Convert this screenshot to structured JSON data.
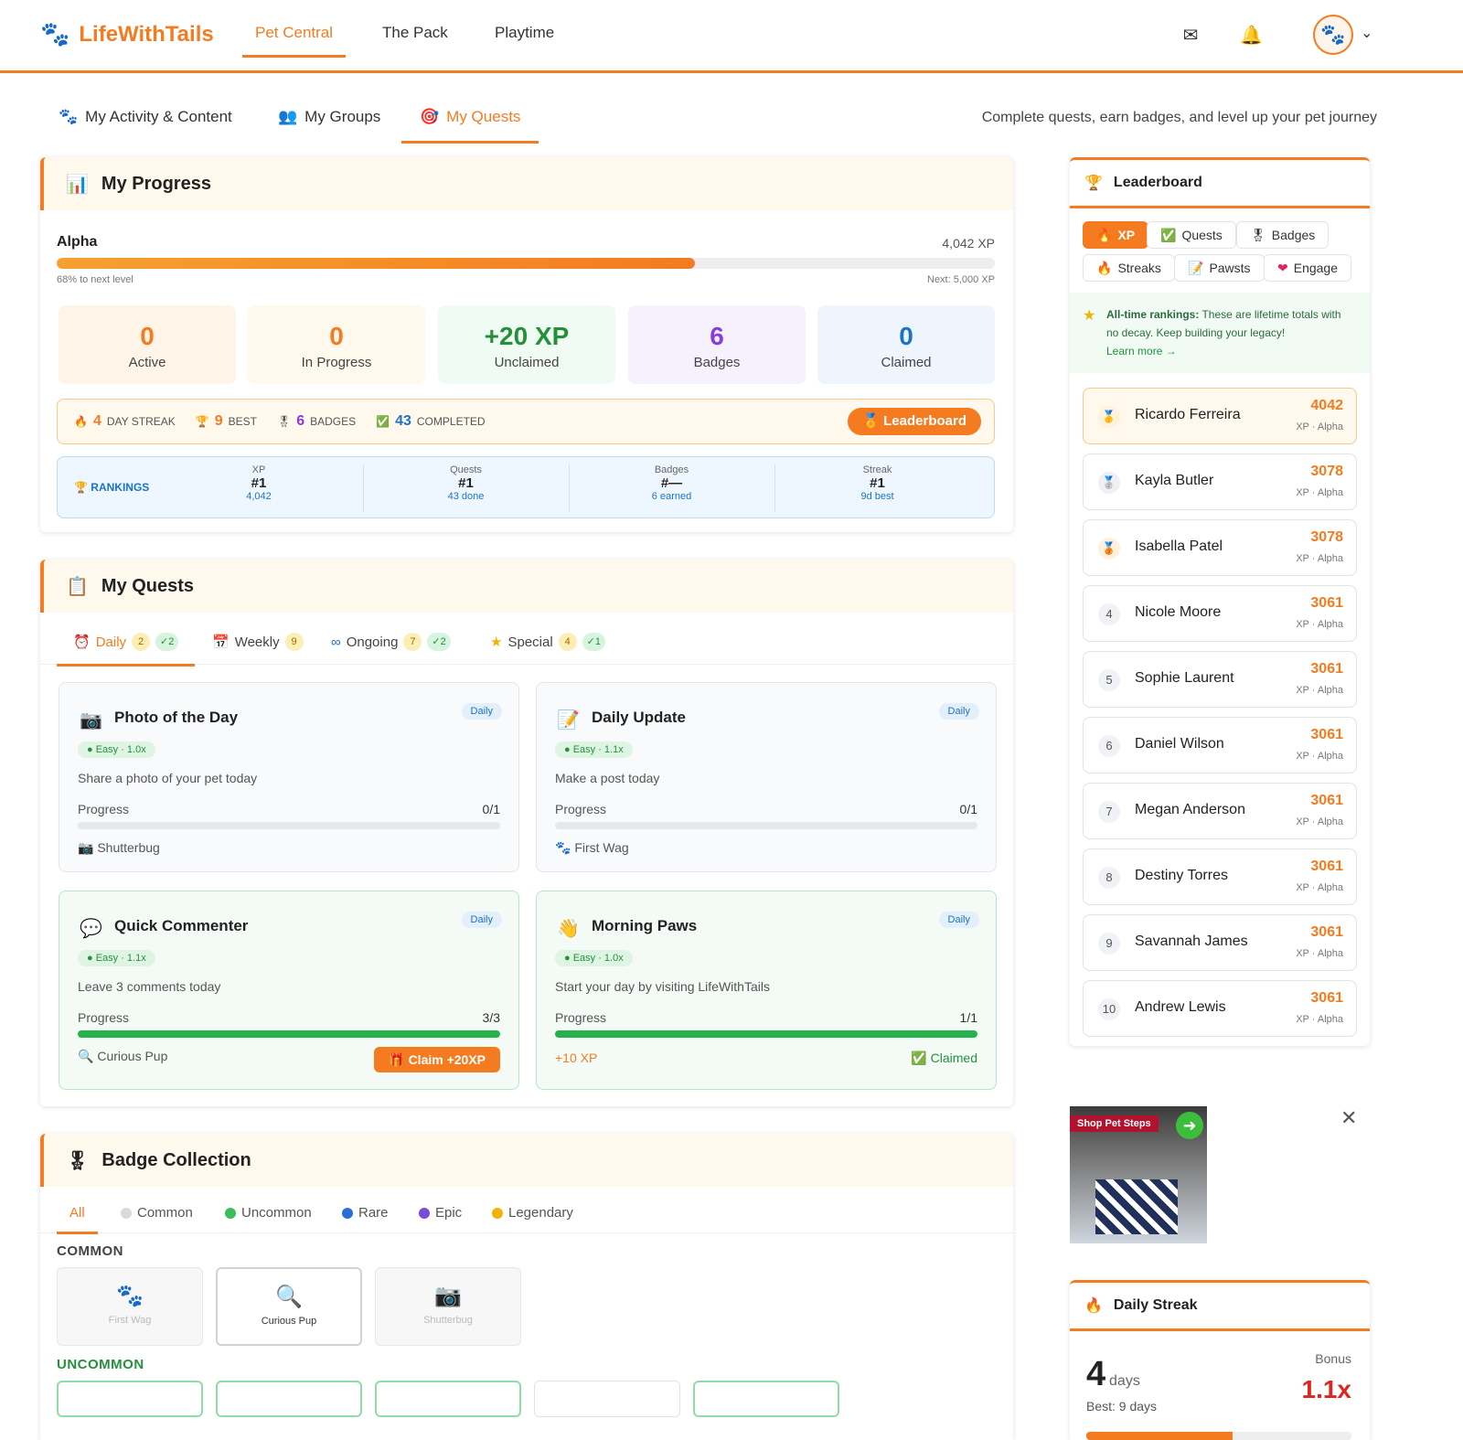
{
  "app": {
    "name": "LifeWithTails"
  },
  "nav": {
    "links": [
      "Pet Central",
      "The Pack",
      "Playtime"
    ]
  },
  "icons": {
    "mail": "mail-icon",
    "bell": "bell-icon",
    "avatar": "paw-avatar",
    "chevron": "chevron-down-icon"
  },
  "subtabs": [
    "My Activity & Content",
    "My Groups",
    "My Quests"
  ],
  "tagline": "Complete quests, earn badges, and level up your pet journey",
  "progress": {
    "title": "My Progress",
    "level": "Alpha",
    "xp": "4,042 XP",
    "percent": 68,
    "to_next": "68% to next level",
    "next": "Next: 5,000 XP",
    "stats": [
      {
        "num": "0",
        "label": "Active",
        "color": "#f47b20",
        "bg": "#fff4e8"
      },
      {
        "num": "0",
        "label": "In Progress",
        "color": "#f47b20",
        "bg": "#fff8ec"
      },
      {
        "num": "+20 XP",
        "label": "Unclaimed",
        "color": "#24913a",
        "bg": "#f0fbf3"
      },
      {
        "num": "6",
        "label": "Badges",
        "color": "#8a3be0",
        "bg": "#f6f2fd"
      },
      {
        "num": "0",
        "label": "Claimed",
        "color": "#1a73c8",
        "bg": "#eef5fd"
      }
    ],
    "streak": {
      "day_streak": "4",
      "day_streak_label": "DAY STREAK",
      "best": "9",
      "best_label": "BEST",
      "badges": "6",
      "badges_label": "BADGES",
      "completed": "43",
      "completed_label": "COMPLETED",
      "leaderboard_btn": "Leaderboard"
    },
    "rankings": {
      "title": "RANKINGS",
      "cells": [
        {
          "k": "XP",
          "v": "#1",
          "s": "4,042"
        },
        {
          "k": "Quests",
          "v": "#1",
          "s": "43 done"
        },
        {
          "k": "Badges",
          "v": "#—",
          "s": "6 earned"
        },
        {
          "k": "Streak",
          "v": "#1",
          "s": "9d best"
        }
      ]
    }
  },
  "quests": {
    "title": "My Quests",
    "tabs": [
      {
        "label": "Daily",
        "count": "2",
        "done": "✓2"
      },
      {
        "label": "Weekly",
        "count": "9",
        "done": ""
      },
      {
        "label": "Ongoing",
        "count": "7",
        "done": "✓2"
      },
      {
        "label": "Special",
        "count": "4",
        "done": "✓1"
      }
    ],
    "progress_label": "Progress",
    "items": [
      {
        "title": "Photo of the Day",
        "tag": "Daily",
        "difficulty": "Easy · 1.0x",
        "desc": "Share a photo of your pet today",
        "progress": "0/1",
        "fill": 0,
        "reward": "Shutterbug"
      },
      {
        "title": "Daily Update",
        "tag": "Daily",
        "difficulty": "Easy · 1.1x",
        "desc": "Make a post today",
        "progress": "0/1",
        "fill": 0,
        "reward": "First Wag"
      },
      {
        "title": "Quick Commenter",
        "tag": "Daily",
        "difficulty": "Easy · 1.1x",
        "desc": "Leave 3 comments today",
        "progress": "3/3",
        "fill": 100,
        "reward": "Curious Pup",
        "claim": "Claim +20XP"
      },
      {
        "title": "Morning Paws",
        "tag": "Daily",
        "difficulty": "Easy · 1.0x",
        "desc": "Start your day by visiting LifeWithTails",
        "progress": "1/1",
        "fill": 100,
        "xp": "+10 XP",
        "claimed": "Claimed"
      }
    ]
  },
  "badges": {
    "title": "Badge Collection",
    "tabs": [
      "All",
      "Common",
      "Uncommon",
      "Rare",
      "Epic",
      "Legendary"
    ],
    "tab_colors": [
      "",
      "#d9d9d9",
      "#3cbd5a",
      "#2a6fd6",
      "#7a4bd6",
      "#f0b400"
    ],
    "sections": {
      "common": "COMMON",
      "uncommon": "UNCOMMON"
    },
    "common": [
      "First Wag",
      "Curious Pup",
      "Shutterbug"
    ]
  },
  "leaderboard": {
    "title": "Leaderboard",
    "chips": [
      "XP",
      "Quests",
      "Badges",
      "Streaks",
      "Pawsts",
      "Engage"
    ],
    "note_bold": "All-time rankings:",
    "note": " These are lifetime totals with no decay. Keep building your legacy!",
    "learn_more": "Learn more →",
    "sub": "XP · Alpha",
    "rows": [
      {
        "rank": "",
        "name": "Ricardo Ferreira",
        "score": "4042"
      },
      {
        "rank": "",
        "name": "Kayla Butler",
        "score": "3078"
      },
      {
        "rank": "",
        "name": "Isabella Patel",
        "score": "3078"
      },
      {
        "rank": "4",
        "name": "Nicole Moore",
        "score": "3061"
      },
      {
        "rank": "5",
        "name": "Sophie Laurent",
        "score": "3061"
      },
      {
        "rank": "6",
        "name": "Daniel Wilson",
        "score": "3061"
      },
      {
        "rank": "7",
        "name": "Megan Anderson",
        "score": "3061"
      },
      {
        "rank": "8",
        "name": "Destiny Torres",
        "score": "3061"
      },
      {
        "rank": "9",
        "name": "Savannah James",
        "score": "3061"
      },
      {
        "rank": "10",
        "name": "Andrew Lewis",
        "score": "3061"
      }
    ]
  },
  "ad": {
    "label": "Shop Pet Steps"
  },
  "daily_streak": {
    "title": "Daily Streak",
    "days": "4",
    "days_label": "days",
    "best": "Best: 9 days",
    "bonus_label": "Bonus",
    "bonus": "1.1x"
  }
}
